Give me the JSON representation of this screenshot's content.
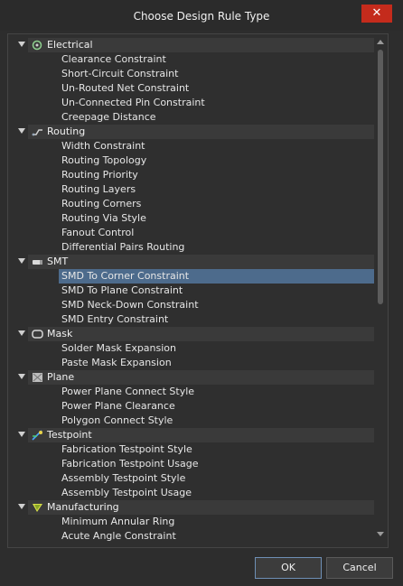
{
  "window": {
    "title": "Choose Design Rule Type",
    "close_label": "✕"
  },
  "categories": [
    {
      "label": "Electrical",
      "icon": "electrical-icon",
      "rules": [
        "Clearance Constraint",
        "Short-Circuit Constraint",
        "Un-Routed Net Constraint",
        "Un-Connected Pin Constraint",
        "Creepage Distance"
      ]
    },
    {
      "label": "Routing",
      "icon": "routing-icon",
      "rules": [
        "Width Constraint",
        "Routing Topology",
        "Routing Priority",
        "Routing Layers",
        "Routing Corners",
        "Routing Via Style",
        "Fanout Control",
        "Differential Pairs Routing"
      ]
    },
    {
      "label": "SMT",
      "icon": "smt-icon",
      "rules": [
        "SMD To Corner Constraint",
        "SMD To Plane Constraint",
        "SMD Neck-Down Constraint",
        "SMD Entry Constraint"
      ]
    },
    {
      "label": "Mask",
      "icon": "mask-icon",
      "rules": [
        "Solder Mask Expansion",
        "Paste Mask Expansion"
      ]
    },
    {
      "label": "Plane",
      "icon": "plane-icon",
      "rules": [
        "Power Plane Connect Style",
        "Power Plane Clearance",
        "Polygon Connect Style"
      ]
    },
    {
      "label": "Testpoint",
      "icon": "testpoint-icon",
      "rules": [
        "Fabrication Testpoint Style",
        "Fabrication Testpoint Usage",
        "Assembly Testpoint Style",
        "Assembly Testpoint Usage"
      ]
    },
    {
      "label": "Manufacturing",
      "icon": "manufacturing-icon",
      "rules": [
        "Minimum Annular Ring",
        "Acute Angle Constraint"
      ]
    }
  ],
  "selected_rule": "SMD To Corner Constraint",
  "buttons": {
    "ok": "OK",
    "cancel": "Cancel"
  },
  "colors": {
    "selection": "#4d6b8c",
    "close": "#c42b1c"
  }
}
